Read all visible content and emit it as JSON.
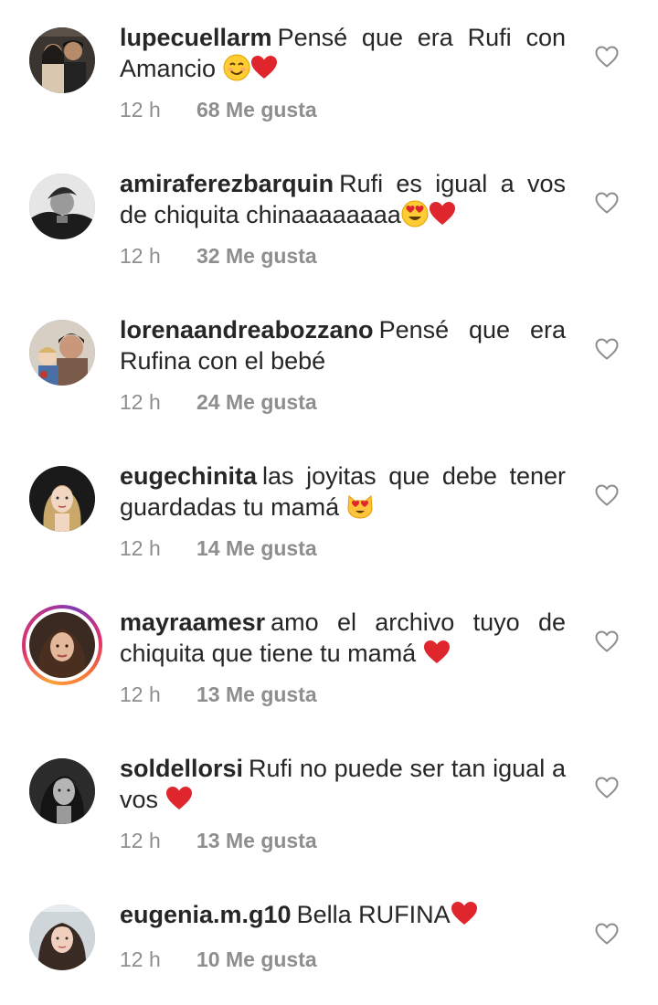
{
  "comments": [
    {
      "username": "lupecuellarm",
      "text": "Pensé que era Rufi con Amancio ",
      "emojis": [
        "smile-emoji",
        "red-heart-emoji"
      ],
      "time": "12 h",
      "likes": "68 Me gusta",
      "avatar": "avatar-couple-photo",
      "story_ring": false
    },
    {
      "username": "amiraferezbarquin",
      "text": "Rufi es igual a vos de chiquita chinaaaaaaaa",
      "emojis": [
        "heart-eyes-emoji",
        "red-heart-emoji"
      ],
      "time": "12 h",
      "likes": "32 Me gusta",
      "avatar": "avatar-bw-portrait",
      "story_ring": false
    },
    {
      "username": "lorenaandreabozzano",
      "text": "Pensé que era Rufina con el bebé",
      "emojis": [],
      "time": "12 h",
      "likes": "24 Me gusta",
      "avatar": "avatar-mother-child",
      "story_ring": false
    },
    {
      "username": "eugechinita",
      "text": "las joyitas que debe tener guardadas tu mamá ",
      "emojis": [
        "heart-eyes-cat-emoji"
      ],
      "time": "12 h",
      "likes": "14 Me gusta",
      "avatar": "avatar-blonde-portrait",
      "story_ring": false
    },
    {
      "username": "mayraamesr",
      "text": "amo el archivo tuyo de chiquita que tiene tu mamá ",
      "emojis": [
        "red-heart-emoji"
      ],
      "time": "12 h",
      "likes": "13 Me gusta",
      "avatar": "avatar-brunette-portrait",
      "story_ring": true
    },
    {
      "username": "soldellorsi",
      "text": "Rufi no puede ser tan igual a vos ",
      "emojis": [
        "red-heart-emoji"
      ],
      "time": "12 h",
      "likes": "13 Me gusta",
      "avatar": "avatar-dark-portrait",
      "story_ring": false
    },
    {
      "username": "eugenia.m.g10",
      "text": "Bella RUFINA",
      "emojis": [
        "red-heart-emoji"
      ],
      "time": "12 h",
      "likes": "10 Me gusta",
      "avatar": "avatar-selfie",
      "story_ring": false
    }
  ],
  "colors": {
    "text": "#262626",
    "meta": "#8e8e8e",
    "heart_outline": "#8e8e8e",
    "emoji_heart": "#e0262d"
  }
}
